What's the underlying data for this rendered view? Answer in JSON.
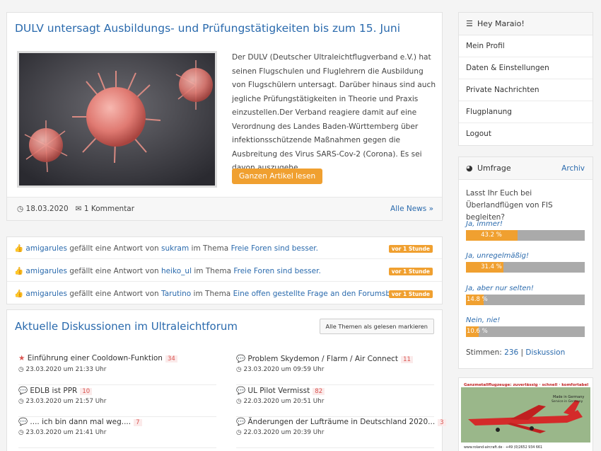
{
  "article": {
    "title": "DULV untersagt Ausbildungs- und Prüfungstätigkeiten bis zum 15. Juni",
    "teaser": "Der DULV (Deutscher Ultraleichtflugverband e.V.) hat seinen Flugschulen und Fluglehrern die Ausbildung von Flugschülern untersagt. Darüber hinaus sind auch jegliche Prüfungstätigkeiten in Theorie und Praxis einzustellen.Der Verband reagiere damit auf eine Verordnung des Landes Baden-Württemberg über infektionsschützende Maßnahmen gegen die Ausbreitung des Virus SARS-Cov-2 (Corona). Es sei davon auszugehe...",
    "read_more": "Ganzen Artikel lesen",
    "date": "18.03.2020",
    "comments": "1 Kommentar",
    "all_news": "Alle News »"
  },
  "activity": [
    {
      "user": "amigarules",
      "mid": " gefällt eine Antwort von ",
      "other": "sukram",
      "mid2": " im Thema ",
      "topic": "Freie Foren sind besser.",
      "time": "vor 1 Stunde"
    },
    {
      "user": "amigarules",
      "mid": " gefällt eine Antwort von ",
      "other": "heiko_ul",
      "mid2": " im Thema ",
      "topic": "Freie Foren sind besser.",
      "time": "vor 1 Stunde"
    },
    {
      "user": "amigarules",
      "mid": " gefällt eine Antwort von ",
      "other": "Tarutino",
      "mid2": " im Thema ",
      "topic": "Eine offen gestellte Frage an den Forumsbetre....",
      "time": "vor 1 Stunde"
    }
  ],
  "discussions": {
    "title": "Aktuelle Diskussionen im Ultraleichtforum",
    "mark_read": "Alle Themen als gelesen markieren",
    "threads": [
      {
        "title": "Einführung einer Cooldown-Funktion",
        "count": "34",
        "date": "23.03.2020 um 21:33 Uhr",
        "icon": "star-icon"
      },
      {
        "title": "Problem Skydemon / Flarm / Air Connect",
        "count": "11",
        "date": "23.03.2020 um 09:59 Uhr",
        "icon": "comments-icon"
      },
      {
        "title": "EDLB ist PPR",
        "count": "10",
        "date": "23.03.2020 um 21:57 Uhr",
        "icon": "comments-icon"
      },
      {
        "title": "UL Pilot Vermisst",
        "count": "82",
        "date": "22.03.2020 um 20:51 Uhr",
        "icon": "comments-icon"
      },
      {
        "title": ".... ich bin dann mal weg....",
        "count": "7",
        "date": "23.03.2020 um 21:41 Uhr",
        "icon": "comments-icon"
      },
      {
        "title": "Änderungen der Lufträume in Deutschland 2020...",
        "count": "3",
        "date": "22.03.2020 um 20:39 Uhr",
        "icon": "comments-icon"
      }
    ]
  },
  "usermenu": {
    "greeting": "Hey Maraio!",
    "items": [
      "Mein Profil",
      "Daten & Einstellungen",
      "Private Nachrichten",
      "Flugplanung",
      "Logout"
    ]
  },
  "poll": {
    "title": "Umfrage",
    "archive": "Archiv",
    "question": "Lasst Ihr Euch bei Überlandflügen von FIS begleiten?",
    "options": [
      {
        "label": "Ja, immer!",
        "pct": "43.2 %",
        "value": 43.2
      },
      {
        "label": "Ja, unregelmäßig!",
        "pct": "31.4 %",
        "value": 31.4
      },
      {
        "label": "Ja, aber nur selten!",
        "pct": "14.8 %",
        "value": 14.8
      },
      {
        "label": "Nein, nie!",
        "pct": "10.6 %",
        "value": 10.6
      }
    ],
    "votes_label": "Stimmen: ",
    "votes": "236",
    "sep": " | ",
    "discussion": "Diskussion"
  },
  "ad": {
    "line1": "Ganzmetallflugzeuge: zuverlässig · schnell · komfortabel",
    "line2": "Made in Germany",
    "line3": "Service in Germany",
    "line4": "www.roland-aircraft.de · +49 (0)2652 934 661"
  },
  "colors": {
    "accent": "#f0a030",
    "link": "#2a6aad",
    "count": "#d9534f"
  }
}
